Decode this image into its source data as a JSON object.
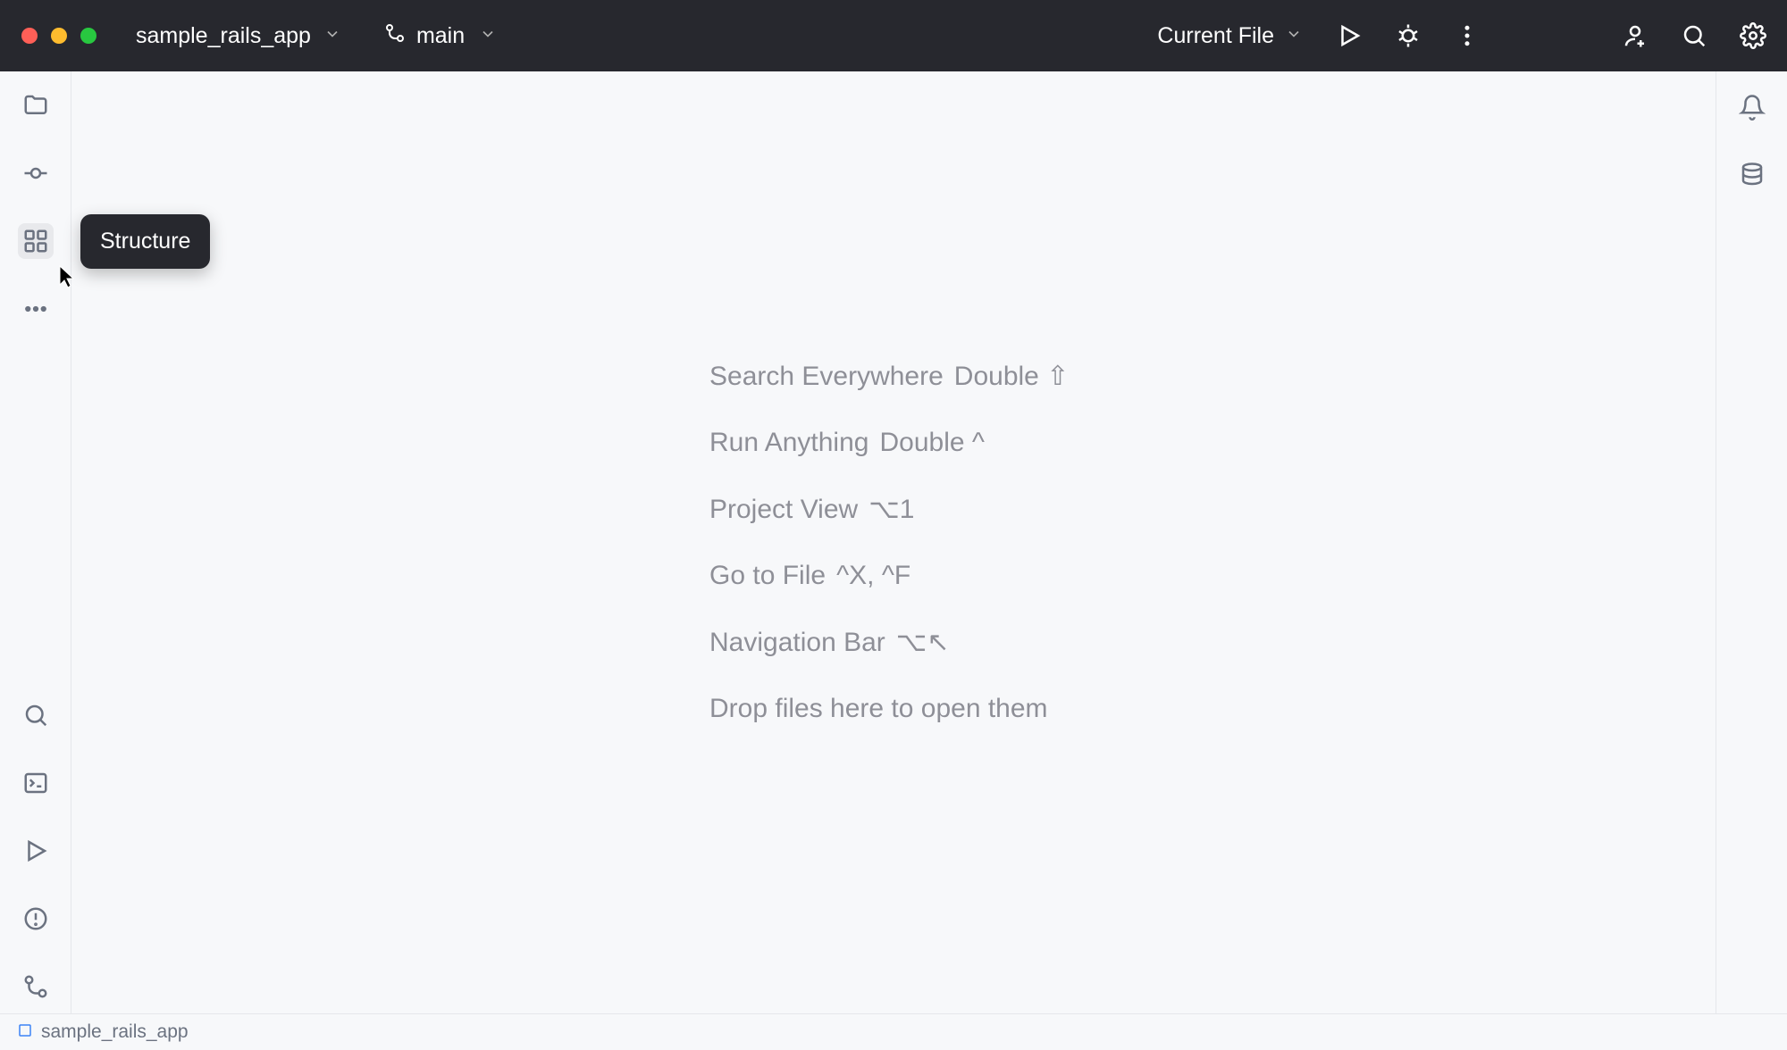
{
  "titlebar": {
    "project_name": "sample_rails_app",
    "branch_name": "main",
    "run_config": "Current File"
  },
  "tooltip": {
    "text": "Structure"
  },
  "left_rail": {
    "top_items": [
      "project",
      "commit",
      "structure",
      "more"
    ],
    "bottom_items": [
      "find",
      "terminal",
      "run",
      "problems",
      "vcs"
    ]
  },
  "right_rail": {
    "items": [
      "notifications",
      "database"
    ]
  },
  "editor_hints": [
    {
      "label": "Search Everywhere",
      "shortcut": "Double ⇧"
    },
    {
      "label": "Run Anything",
      "shortcut": "Double ^"
    },
    {
      "label": "Project View",
      "shortcut": "⌥1"
    },
    {
      "label": "Go to File",
      "shortcut": "^X, ^F"
    },
    {
      "label": "Navigation Bar",
      "shortcut": "⌥↖"
    },
    {
      "label": "Drop files here to open them",
      "shortcut": ""
    }
  ],
  "footer": {
    "project_label": "sample_rails_app"
  }
}
